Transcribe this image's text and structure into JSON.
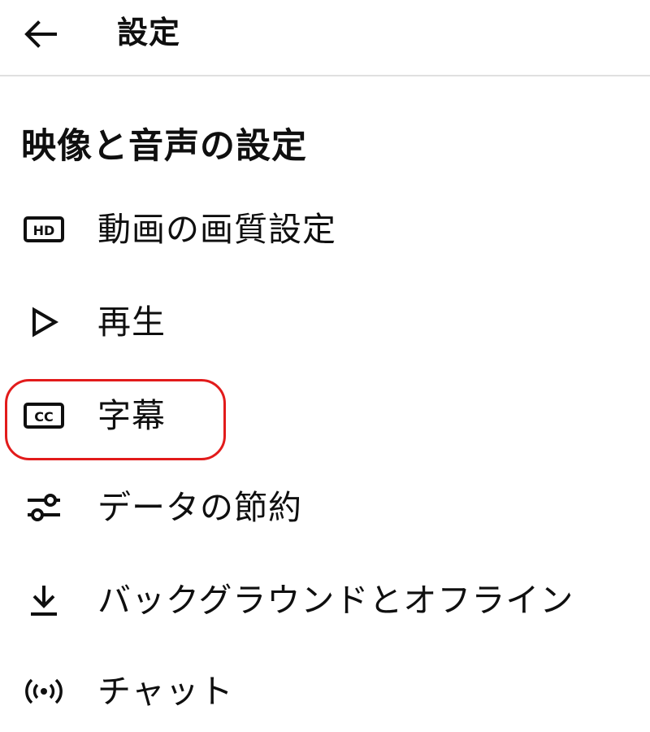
{
  "header": {
    "title": "設定",
    "back_icon": "arrow-left-icon"
  },
  "section": {
    "title": "映像と音声の設定"
  },
  "menu": {
    "items": [
      {
        "label": "動画の画質設定",
        "icon": "hd-icon"
      },
      {
        "label": "再生",
        "icon": "play-icon"
      },
      {
        "label": "字幕",
        "icon": "closed-captions-icon"
      },
      {
        "label": "データの節約",
        "icon": "sliders-icon"
      },
      {
        "label": "バックグラウンドとオフライン",
        "icon": "download-icon"
      },
      {
        "label": "チャット",
        "icon": "broadcast-icon"
      }
    ]
  },
  "colors": {
    "text": "#0f0f0f",
    "divider": "#e0e0e0",
    "highlight_outline": "#e21b1b"
  }
}
